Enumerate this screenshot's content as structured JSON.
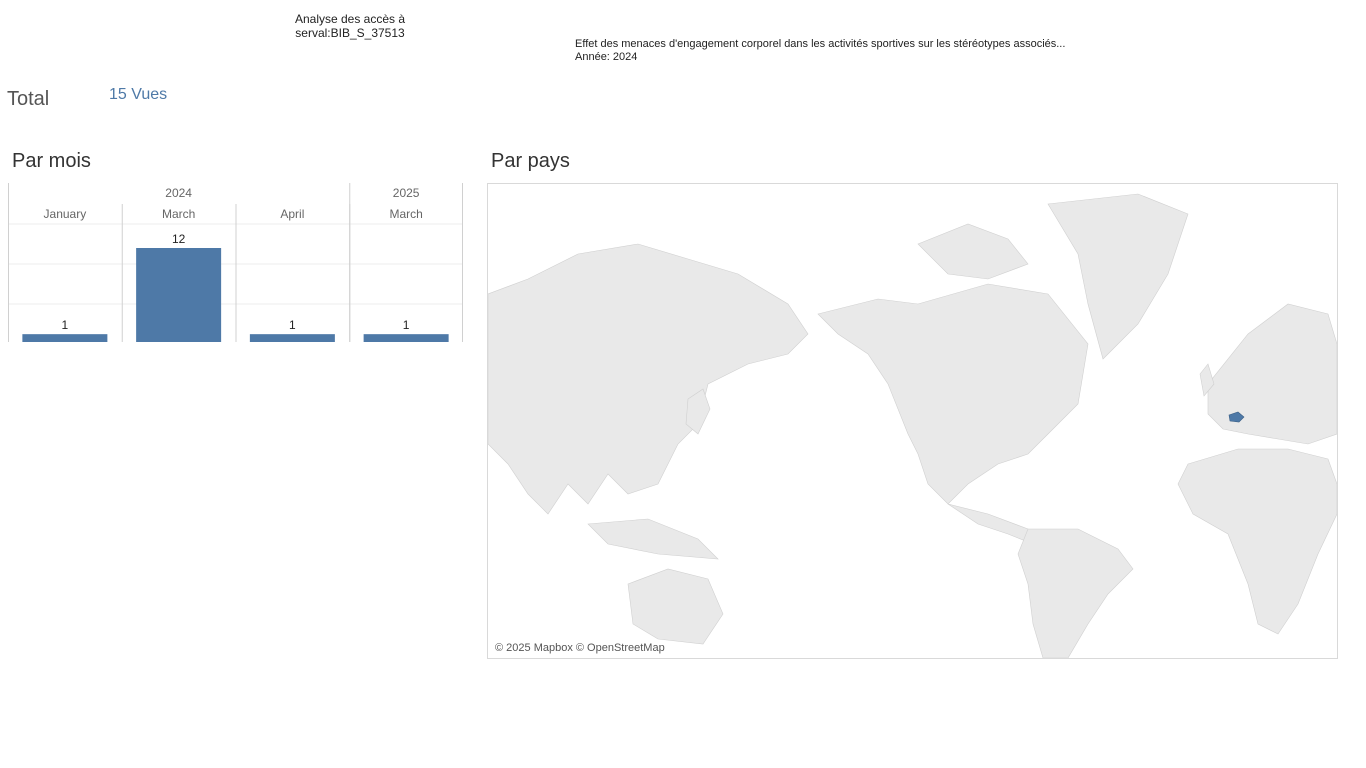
{
  "header": {
    "title_line1": "Analyse des accès à",
    "title_line2": "serval:BIB_S_37513",
    "publication_title": "Effet des menaces d'engagement corporel dans les activités sportives sur les stéréotypes associés...",
    "publication_year": "Année: 2024"
  },
  "total": {
    "label": "Total",
    "value": "15 Vues"
  },
  "sections": {
    "by_month": "Par mois",
    "by_country": "Par pays"
  },
  "chart_data": {
    "type": "bar",
    "title": "Par mois",
    "year_groups": [
      {
        "year": "2024",
        "months": [
          "January",
          "March",
          "April"
        ]
      },
      {
        "year": "2025",
        "months": [
          "March"
        ]
      }
    ],
    "categories": [
      "January",
      "March",
      "April",
      "March"
    ],
    "values": [
      1,
      12,
      1,
      1
    ],
    "ylim": [
      0,
      12
    ],
    "bar_color": "#4e79a7",
    "grid": true
  },
  "map": {
    "highlighted_country": "Switzerland",
    "highlight_color": "#4e79a7",
    "land_color": "#e8e8e8",
    "credit": "© 2025 Mapbox © OpenStreetMap"
  }
}
